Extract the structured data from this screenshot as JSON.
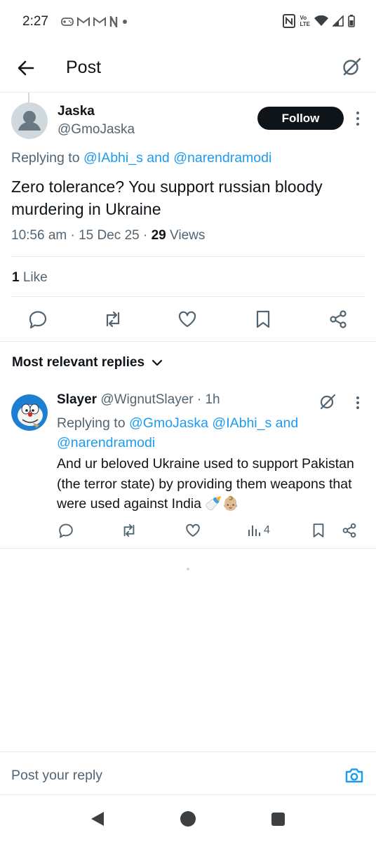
{
  "status_bar": {
    "time": "2:27",
    "left_icons": [
      "gamepad-icon",
      "gmail-icon",
      "gmail-icon",
      "n-icon",
      "dot-icon"
    ],
    "right_icons": [
      "nfc-icon",
      "volte-icon",
      "wifi-icon",
      "signal-icon",
      "battery-icon"
    ],
    "volte_top": "Vo",
    "volte_bottom": "LTE"
  },
  "header": {
    "title": "Post",
    "back_icon": "arrow-left-icon",
    "grok_icon": "grok-icon"
  },
  "post": {
    "author_name": "Jaska",
    "author_handle": "@GmoJaska",
    "follow_label": "Follow",
    "replying_prefix": "Replying to ",
    "replying_user1": "@IAbhi_s",
    "replying_and": " and ",
    "replying_user2": "@narendramodi",
    "text": "Zero tolerance? You support russian bloody murdering in Ukraine",
    "time": "10:56 am · 15 Dec 25 · ",
    "views_count": "29",
    "views_label": " Views",
    "likes_count": "1",
    "likes_label": " Like",
    "actions": [
      "reply-icon",
      "repost-icon",
      "like-icon",
      "bookmark-icon",
      "share-icon"
    ]
  },
  "replies_section": {
    "sort_label": "Most relevant replies"
  },
  "reply": {
    "name": "Slayer",
    "handle_time": " @WignutSlayer · 1h",
    "replying_prefix": "Replying to ",
    "replying_users": "@GmoJaska @IAbhi_s and @narendramodi",
    "text": "And ur beloved Ukraine used to support Pakistan (the terror state) by providing them weapons that were used against India 🍼👶🏼",
    "views_count": "4"
  },
  "compose": {
    "placeholder": "Post your reply"
  },
  "colors": {
    "link": "#1d9bf0",
    "secondary_text": "#536471",
    "follow_bg": "#0f1419"
  }
}
